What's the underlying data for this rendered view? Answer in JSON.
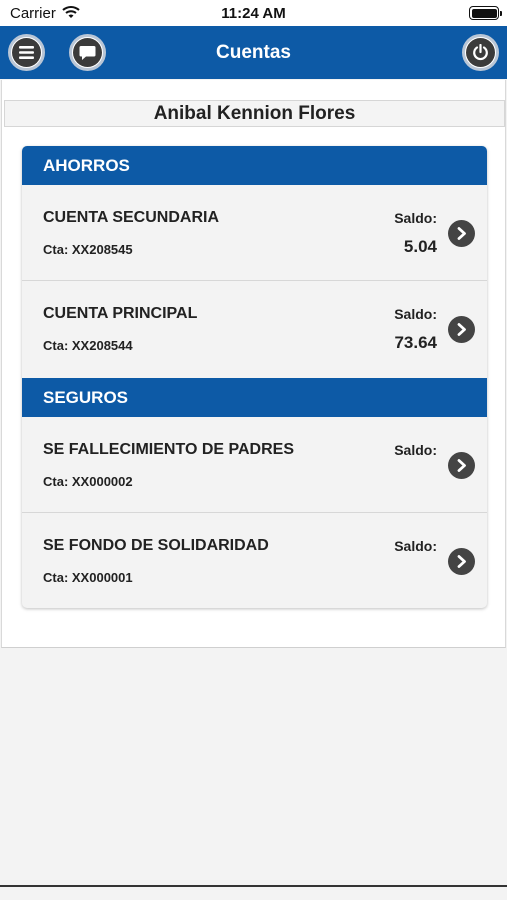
{
  "status_bar": {
    "carrier": "Carrier",
    "time": "11:24 AM"
  },
  "header": {
    "title": "Cuentas",
    "menu_icon": "menu-icon",
    "chat_icon": "chat-icon",
    "power_icon": "power-icon"
  },
  "user": {
    "name": "Anibal Kennion Flores"
  },
  "colors": {
    "primary": "#0d5aa6",
    "card_bg": "#f3f3f3",
    "chevron": "#444444"
  },
  "sections": [
    {
      "title": "AHORROS",
      "accounts": [
        {
          "name": "CUENTA SECUNDARIA",
          "number": "Cta: XX208545",
          "saldo_label": "Saldo:",
          "saldo": "5.04"
        },
        {
          "name": "CUENTA PRINCIPAL",
          "number": "Cta: XX208544",
          "saldo_label": "Saldo:",
          "saldo": "73.64"
        }
      ]
    },
    {
      "title": "SEGUROS",
      "accounts": [
        {
          "name": "SE FALLECIMIENTO DE PADRES",
          "number": "Cta: XX000002",
          "saldo_label": "Saldo:",
          "saldo": ""
        },
        {
          "name": "SE FONDO DE SOLIDARIDAD",
          "number": "Cta: XX000001",
          "saldo_label": "Saldo:",
          "saldo": ""
        }
      ]
    }
  ]
}
